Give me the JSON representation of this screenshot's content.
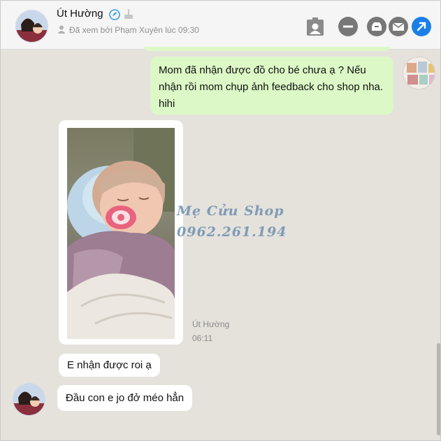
{
  "header": {
    "contact_name": "Út Hường",
    "seen_status": "Đã xem bởi Phạm Xuyên lúc 09:30"
  },
  "messages": {
    "outgoing_text": "Mom đã nhận được đồ cho bé chưa ạ ? Nếu nhận rồi mom chụp ảnh feedback cho shop nha. hihi",
    "photo": {
      "watermark_line1": "Mẹ Cửu Shop",
      "watermark_line2": "0962.261.194",
      "sender": "Út Hường",
      "time": "06:11"
    },
    "incoming": [
      "E nhận được roi ạ",
      "Đầu con e jo đở méo hẳn"
    ]
  },
  "colors": {
    "outgoing_bubble": "#dcf8c6",
    "incoming_bubble": "#ffffff",
    "background": "#e5e2dc",
    "accent": "#1a7ee8"
  }
}
